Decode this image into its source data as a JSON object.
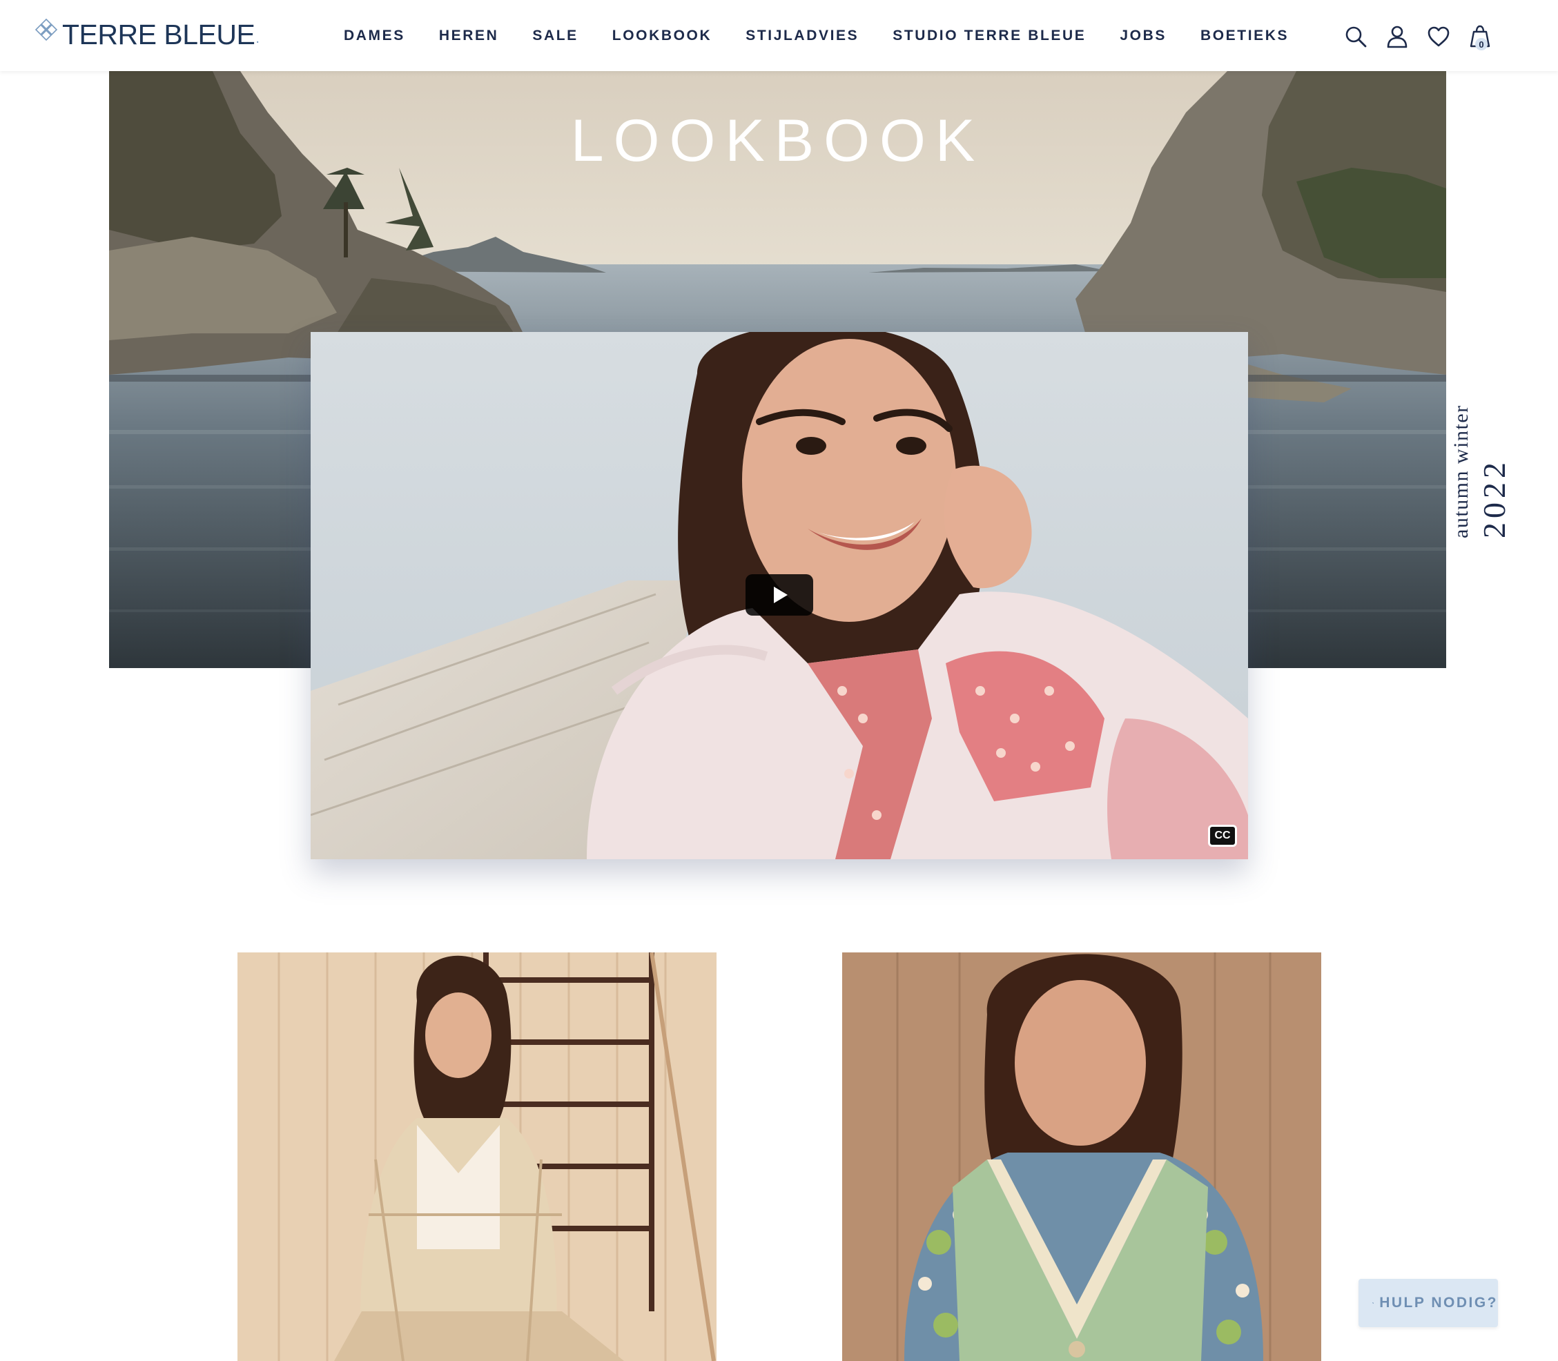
{
  "brand": {
    "name": "TERRE BLEUE",
    "dot": ".",
    "color": "#1d3557",
    "mark_icon": "diamond-lattice-icon"
  },
  "nav": {
    "items": [
      {
        "label": "DAMES"
      },
      {
        "label": "HEREN"
      },
      {
        "label": "SALE"
      },
      {
        "label": "LOOKBOOK"
      },
      {
        "label": "STIJLADVIES"
      },
      {
        "label": "STUDIO TERRE BLEUE"
      },
      {
        "label": "JOBS"
      },
      {
        "label": "BOETIEKS"
      }
    ]
  },
  "header_icons": {
    "search": "search-icon",
    "account": "user-icon",
    "wishlist": "heart-icon",
    "cart": "shopping-bag-icon",
    "cart_count": "0"
  },
  "hero": {
    "title": "LOOKBOOK",
    "season_label": "autumn winter",
    "season_year": "2022"
  },
  "video": {
    "play_icon": "play-icon",
    "captions_label": "CC"
  },
  "help": {
    "label": "HULP NODIG?",
    "icon": "chat-bubbles-icon",
    "color": "#6f8fb3"
  }
}
